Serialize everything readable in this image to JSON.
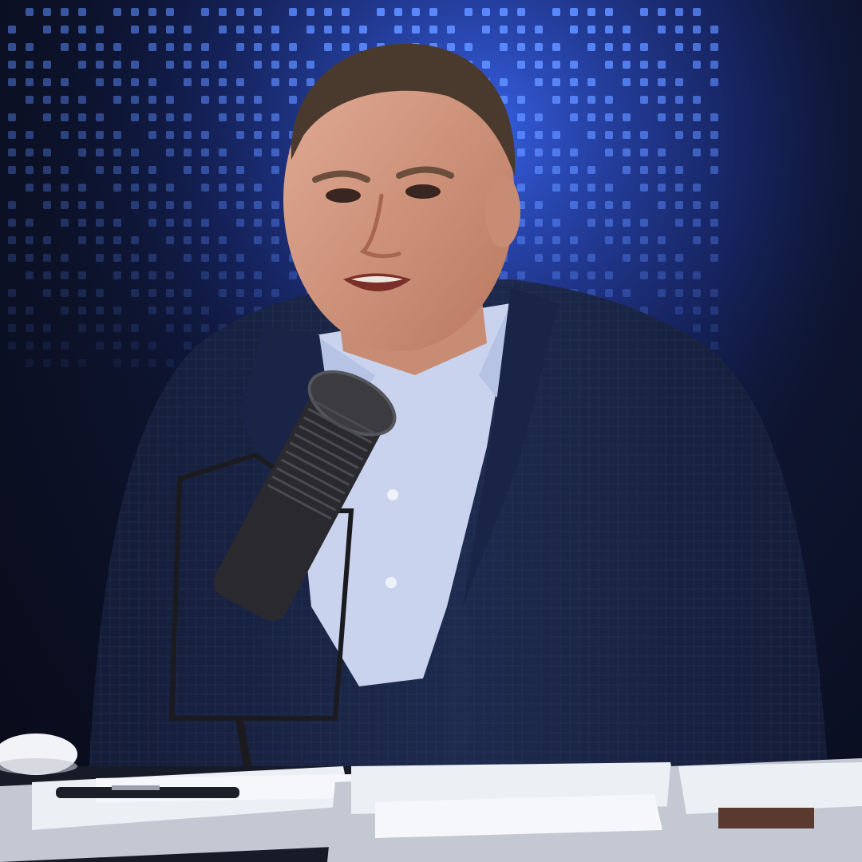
{
  "scene": {
    "kind": "broadcast-studio-still",
    "colors": {
      "background": "#0b0f1e",
      "screen_glow": "#3c6cff",
      "screen_dot": "#5d8cff",
      "suit": "#1e2a4e",
      "suit_shadow": "#141c36",
      "shirt": "#c9d3ee",
      "skin": "#d9a08a",
      "skin_shadow": "#b9785f",
      "hair": "#4a3a2e",
      "mic": "#2a2a2e",
      "mic_grille": "#3b3b40",
      "paper": "#eceff4",
      "paper_shadow": "#c3c8d2",
      "mouse": "#f2f3f6"
    },
    "icons": {
      "microphone": "microphone-icon",
      "mouse": "computer-mouse-icon",
      "pen": "pen-icon"
    }
  }
}
